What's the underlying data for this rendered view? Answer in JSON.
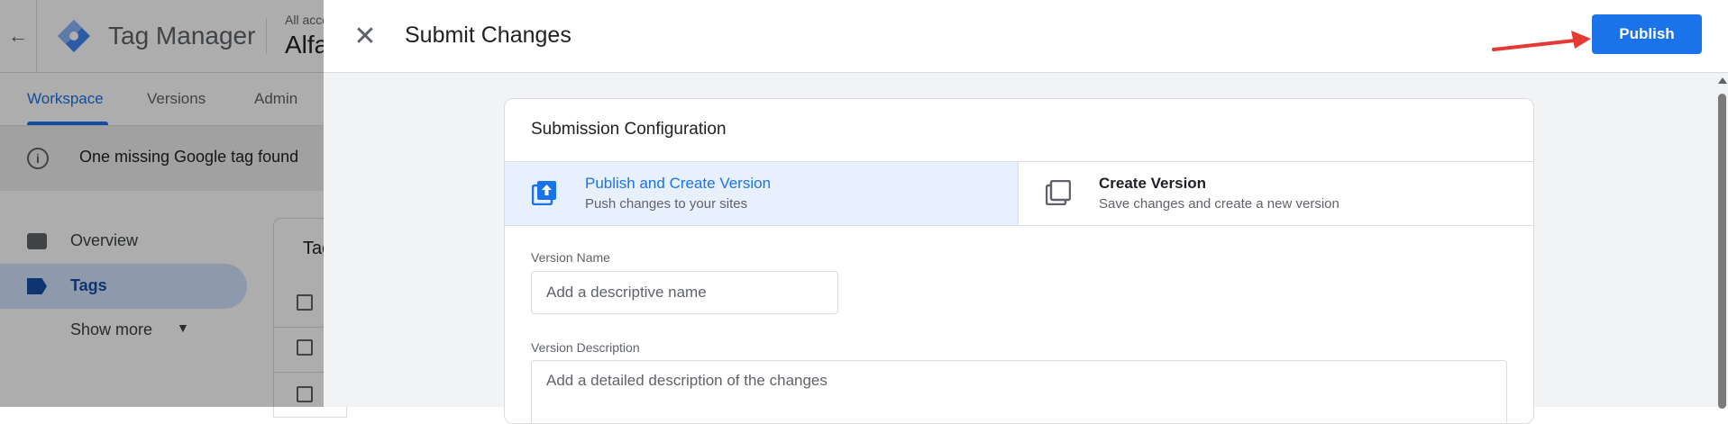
{
  "app": {
    "name": "Tag Manager",
    "account_label": "All acco",
    "account_name": "Alfa"
  },
  "nav": {
    "tabs": [
      {
        "label": "Workspace",
        "active": true
      },
      {
        "label": "Versions",
        "active": false
      },
      {
        "label": "Admin",
        "active": false
      }
    ]
  },
  "alert": {
    "text": "One missing Google tag found"
  },
  "sidebar": {
    "items": [
      {
        "label": "Overview",
        "icon": "folder-icon"
      },
      {
        "label": "Tags",
        "icon": "tag-icon",
        "active": true
      }
    ],
    "show_more": "Show more"
  },
  "content": {
    "title_partial": "Tag"
  },
  "modal": {
    "title": "Submit Changes",
    "publish_label": "Publish",
    "card": {
      "title": "Submission Configuration",
      "options": [
        {
          "title": "Publish and Create Version",
          "subtitle": "Push changes to your sites",
          "selected": true
        },
        {
          "title": "Create Version",
          "subtitle": "Save changes and create a new version",
          "selected": false
        }
      ],
      "version_name_label": "Version Name",
      "version_name_placeholder": "Add a descriptive name",
      "version_description_label": "Version Description",
      "version_description_placeholder": "Add a detailed description of the changes"
    }
  },
  "colors": {
    "accent": "#1a73e8",
    "annotation_arrow": "#e53935"
  }
}
